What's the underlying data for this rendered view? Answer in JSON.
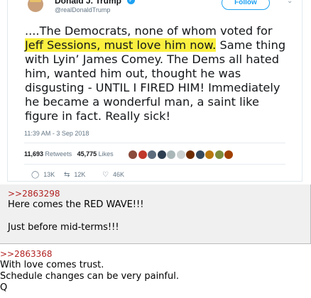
{
  "tweet": {
    "name": "Donald J. Trump",
    "handle": "@realDonaldTrump",
    "follow_label": "Follow",
    "text_lines": [
      {
        "pre": "....The Democrats, none of whom voted for",
        "hl": "",
        "post": ""
      },
      {
        "pre": "",
        "hl": "Jeff Sessions, must love him now.",
        "post": " Same thing"
      },
      {
        "pre": "with Lyin’ James Comey. The Dems all hated",
        "hl": "",
        "post": ""
      },
      {
        "pre": "him, wanted him out, thought he was",
        "hl": "",
        "post": ""
      },
      {
        "pre": "disgusting - UNTIL I FIRED HIM! Immediately",
        "hl": "",
        "post": ""
      },
      {
        "pre": "he became a wonderful man, a saint like",
        "hl": "",
        "post": ""
      },
      {
        "pre": "figure in fact. Really sick!",
        "hl": "",
        "post": ""
      }
    ],
    "time": "11:39 AM - 3 Sep 2018",
    "retweets_count": "11,693",
    "retweets_label": "Retweets",
    "likes_count": "45,775",
    "likes_label": "Likes",
    "liker_colors": [
      "#8a4b3c",
      "#c0392b",
      "#5d6d7e",
      "#2c3e50",
      "#aab7b8",
      "#ccd1d1",
      "#6e2c00",
      "#34495e",
      "#b9770e",
      "#7d8c3a",
      "#a04000"
    ],
    "actions": {
      "replies": "13K",
      "retweets": "12K",
      "likes": "46K"
    }
  },
  "posts": [
    {
      "ref": ">>2863298",
      "lines": [
        "Here comes the RED WAVE!!!",
        "",
        "Just before mid-terms!!!"
      ]
    },
    {
      "ref": ">>2863368",
      "lines": [
        "With love comes trust.",
        "Schedule changes can be very painful.",
        "Q"
      ]
    }
  ]
}
